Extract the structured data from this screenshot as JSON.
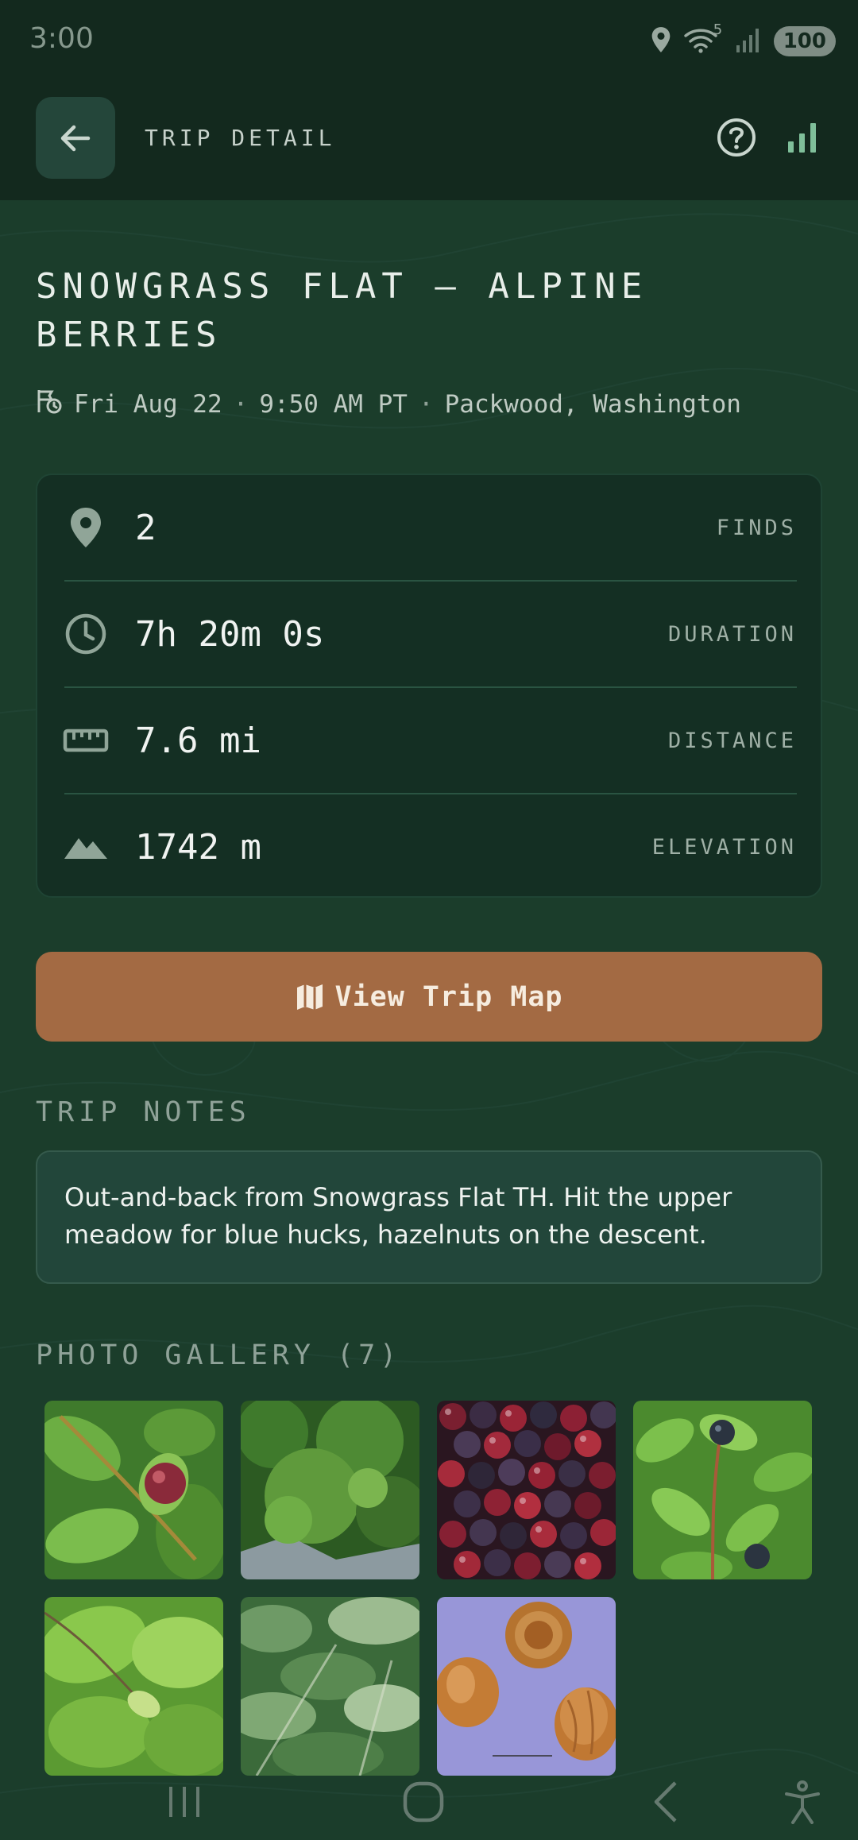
{
  "status_bar": {
    "time": "3:00",
    "battery": "100",
    "wifi_badge": "5"
  },
  "app_bar": {
    "title": "TRIP DETAIL"
  },
  "trip": {
    "title": "SNOWGRASS FLAT — ALPINE BERRIES",
    "date": "Fri Aug 22",
    "time": "9:50 AM PT",
    "location": "Packwood, Washington",
    "separator": "·"
  },
  "stats": [
    {
      "value": "2",
      "label": "FINDS",
      "icon": "location-pin-icon"
    },
    {
      "value": "7h 20m 0s",
      "label": "DURATION",
      "icon": "clock-icon"
    },
    {
      "value": "7.6 mi",
      "label": "DISTANCE",
      "icon": "ruler-icon"
    },
    {
      "value": "1742 m",
      "label": "ELEVATION",
      "icon": "mountain-icon"
    }
  ],
  "map_button": {
    "label": "View Trip Map",
    "icon": "map-icon"
  },
  "notes": {
    "heading": "TRIP NOTES",
    "text": "Out-and-back from Snowgrass Flat TH. Hit the upper meadow for blue hucks, hazelnuts on the descent."
  },
  "gallery": {
    "heading": "PHOTO GALLERY (7)",
    "photos": [
      "berry-on-branch-photo",
      "shrub-photo",
      "berry-pile-photo",
      "blue-huckleberry-photo",
      "hazelnut-leaves-photo",
      "hazel-shrub-photo",
      "hazelnuts-photo"
    ]
  },
  "colors": {
    "background": "#1b3d2b",
    "app_bar": "#13291e",
    "card": "#142f23",
    "accent_button": "#a36a43",
    "icon_green": "#7fbf9a"
  }
}
